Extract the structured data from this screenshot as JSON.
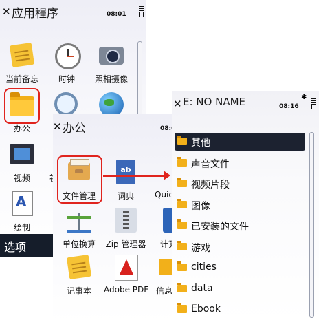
{
  "screens": {
    "apps": {
      "title": "应用程序",
      "time": "08:01",
      "tiles": [
        {
          "label": "当前备忘"
        },
        {
          "label": "时钟"
        },
        {
          "label": "照相摄像"
        },
        {
          "label": "办公"
        },
        {
          "label": ""
        },
        {
          "label": ""
        },
        {
          "label": "视频"
        },
        {
          "label": "视"
        },
        {
          "label": "绘制"
        }
      ],
      "softkey_left": "选项"
    },
    "office": {
      "title": "办公",
      "time": "08:0",
      "tiles": [
        {
          "label": "文件管理"
        },
        {
          "label": "词典"
        },
        {
          "label": "Quick"
        },
        {
          "label": "单位换算"
        },
        {
          "label": "Zip 管理器"
        },
        {
          "label": "计算"
        },
        {
          "label": "记事本"
        },
        {
          "label": "Adobe PDF"
        },
        {
          "label": "信息"
        }
      ]
    },
    "file_manager": {
      "title": "E: NO NAME",
      "time": "08:16",
      "folders": [
        {
          "name": "其他",
          "selected": true
        },
        {
          "name": "声音文件",
          "selected": false
        },
        {
          "name": "视频片段",
          "selected": false
        },
        {
          "name": "图像",
          "selected": false
        },
        {
          "name": "已安装的文件",
          "selected": false
        },
        {
          "name": "游戏",
          "selected": false
        },
        {
          "name": "cities",
          "selected": false
        },
        {
          "name": "data",
          "selected": false
        },
        {
          "name": "Ebook",
          "selected": false
        }
      ]
    }
  },
  "colors": {
    "highlight": "#e0241e",
    "selected_row": "#1c2230",
    "softkey_bar": "#151d2a",
    "folder": "#f2b01a"
  }
}
